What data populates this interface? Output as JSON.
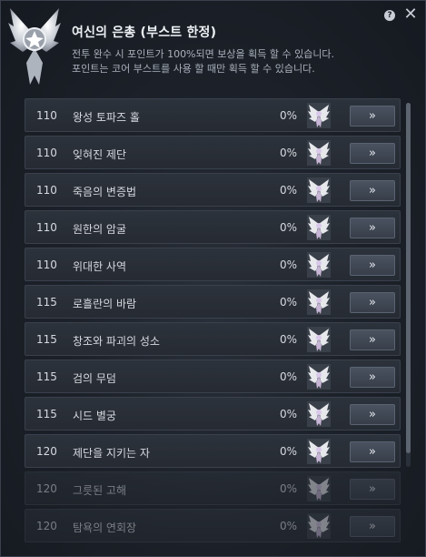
{
  "header": {
    "title": "여신의 은총 (부스트 한정)",
    "desc_line1": "전투 완수 시 포인트가 100%되면 보상을 획득 할 수 있습니다.",
    "desc_line2": "포인트는 코어 부스트를 사용 할 때만 획득 할 수 있습니다.",
    "help_label": "?",
    "close_label": "✕"
  },
  "rows": [
    {
      "level": "110",
      "name": "왕성 토파즈 홀",
      "percent": "0%",
      "button": "»",
      "enabled": true
    },
    {
      "level": "110",
      "name": "잊혀진 제단",
      "percent": "0%",
      "button": "»",
      "enabled": true
    },
    {
      "level": "110",
      "name": "죽음의 변증법",
      "percent": "0%",
      "button": "»",
      "enabled": true
    },
    {
      "level": "110",
      "name": "원한의 암굴",
      "percent": "0%",
      "button": "»",
      "enabled": true
    },
    {
      "level": "110",
      "name": "위대한 사역",
      "percent": "0%",
      "button": "»",
      "enabled": true
    },
    {
      "level": "115",
      "name": "로흘란의 바람",
      "percent": "0%",
      "button": "»",
      "enabled": true
    },
    {
      "level": "115",
      "name": "창조와 파괴의 성소",
      "percent": "0%",
      "button": "»",
      "enabled": true
    },
    {
      "level": "115",
      "name": "검의 무덤",
      "percent": "0%",
      "button": "»",
      "enabled": true
    },
    {
      "level": "115",
      "name": "시드 별궁",
      "percent": "0%",
      "button": "»",
      "enabled": true
    },
    {
      "level": "120",
      "name": "제단을 지키는 자",
      "percent": "0%",
      "button": "»",
      "enabled": true
    },
    {
      "level": "120",
      "name": "그릇된 고해",
      "percent": "0%",
      "button": "»",
      "enabled": false
    },
    {
      "level": "120",
      "name": "탐욕의 연회장",
      "percent": "0%",
      "button": "»",
      "enabled": false
    }
  ],
  "icons": {
    "emblem": "winged-goddess-emblem-icon",
    "reward": "angel-wings-reward-icon",
    "help": "help-icon",
    "close": "close-icon"
  },
  "colors": {
    "background": "#1d222a",
    "row": "#2a3039",
    "button": "#434b58",
    "text": "#d6dae0"
  }
}
